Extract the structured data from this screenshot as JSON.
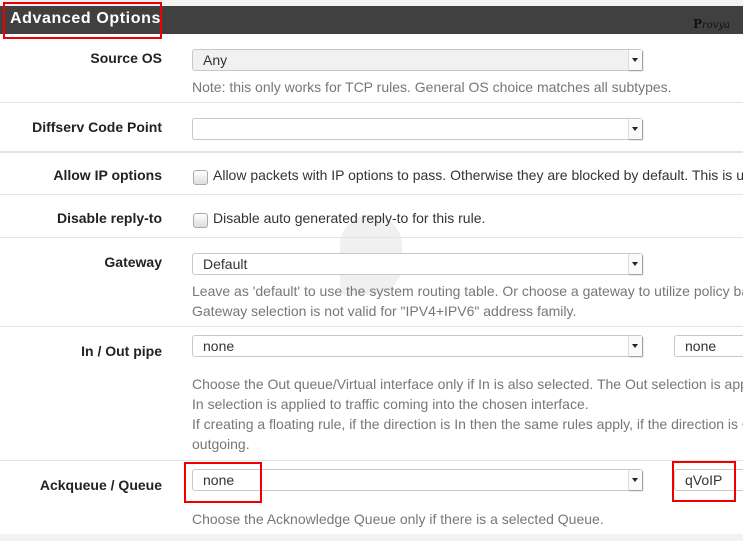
{
  "header": {
    "title": "Advanced Options",
    "logo_text": "rovya",
    "logo_initial": "P"
  },
  "rows": {
    "source_os": {
      "label": "Source OS",
      "value": "Any",
      "help": "Note: this only works for TCP rules. General OS choice matches all subtypes."
    },
    "diffserv": {
      "label": "Diffserv Code Point",
      "value": ""
    },
    "allow_ip": {
      "label": "Allow IP options",
      "checkbox_text": "Allow packets with IP options to pass. Otherwise they are blocked by default. This is us",
      "checked": false
    },
    "disable_reply": {
      "label": "Disable reply-to",
      "checkbox_text": "Disable auto generated reply-to for this rule.",
      "checked": false
    },
    "gateway": {
      "label": "Gateway",
      "value": "Default",
      "help_1": "Leave as 'default' to use the system routing table. Or choose a gateway to utilize policy ba",
      "help_2": "Gateway selection is not valid for \"IPV4+IPV6\" address family."
    },
    "pipe": {
      "label": "In / Out pipe",
      "in_value": "none",
      "out_value": "none",
      "help_1": "Choose the Out queue/Virtual interface only if In is also selected. The Out selection is appl",
      "help_2": "In selection is applied to traffic coming into the chosen interface.",
      "help_3": "If creating a floating rule, if the direction is In then the same rules apply, if the direction is O",
      "help_4": "outgoing."
    },
    "queue": {
      "label": "Ackqueue / Queue",
      "ack_value": "none",
      "queue_value": "qVoIP",
      "help": "Choose the Acknowledge Queue only if there is a selected Queue."
    }
  }
}
